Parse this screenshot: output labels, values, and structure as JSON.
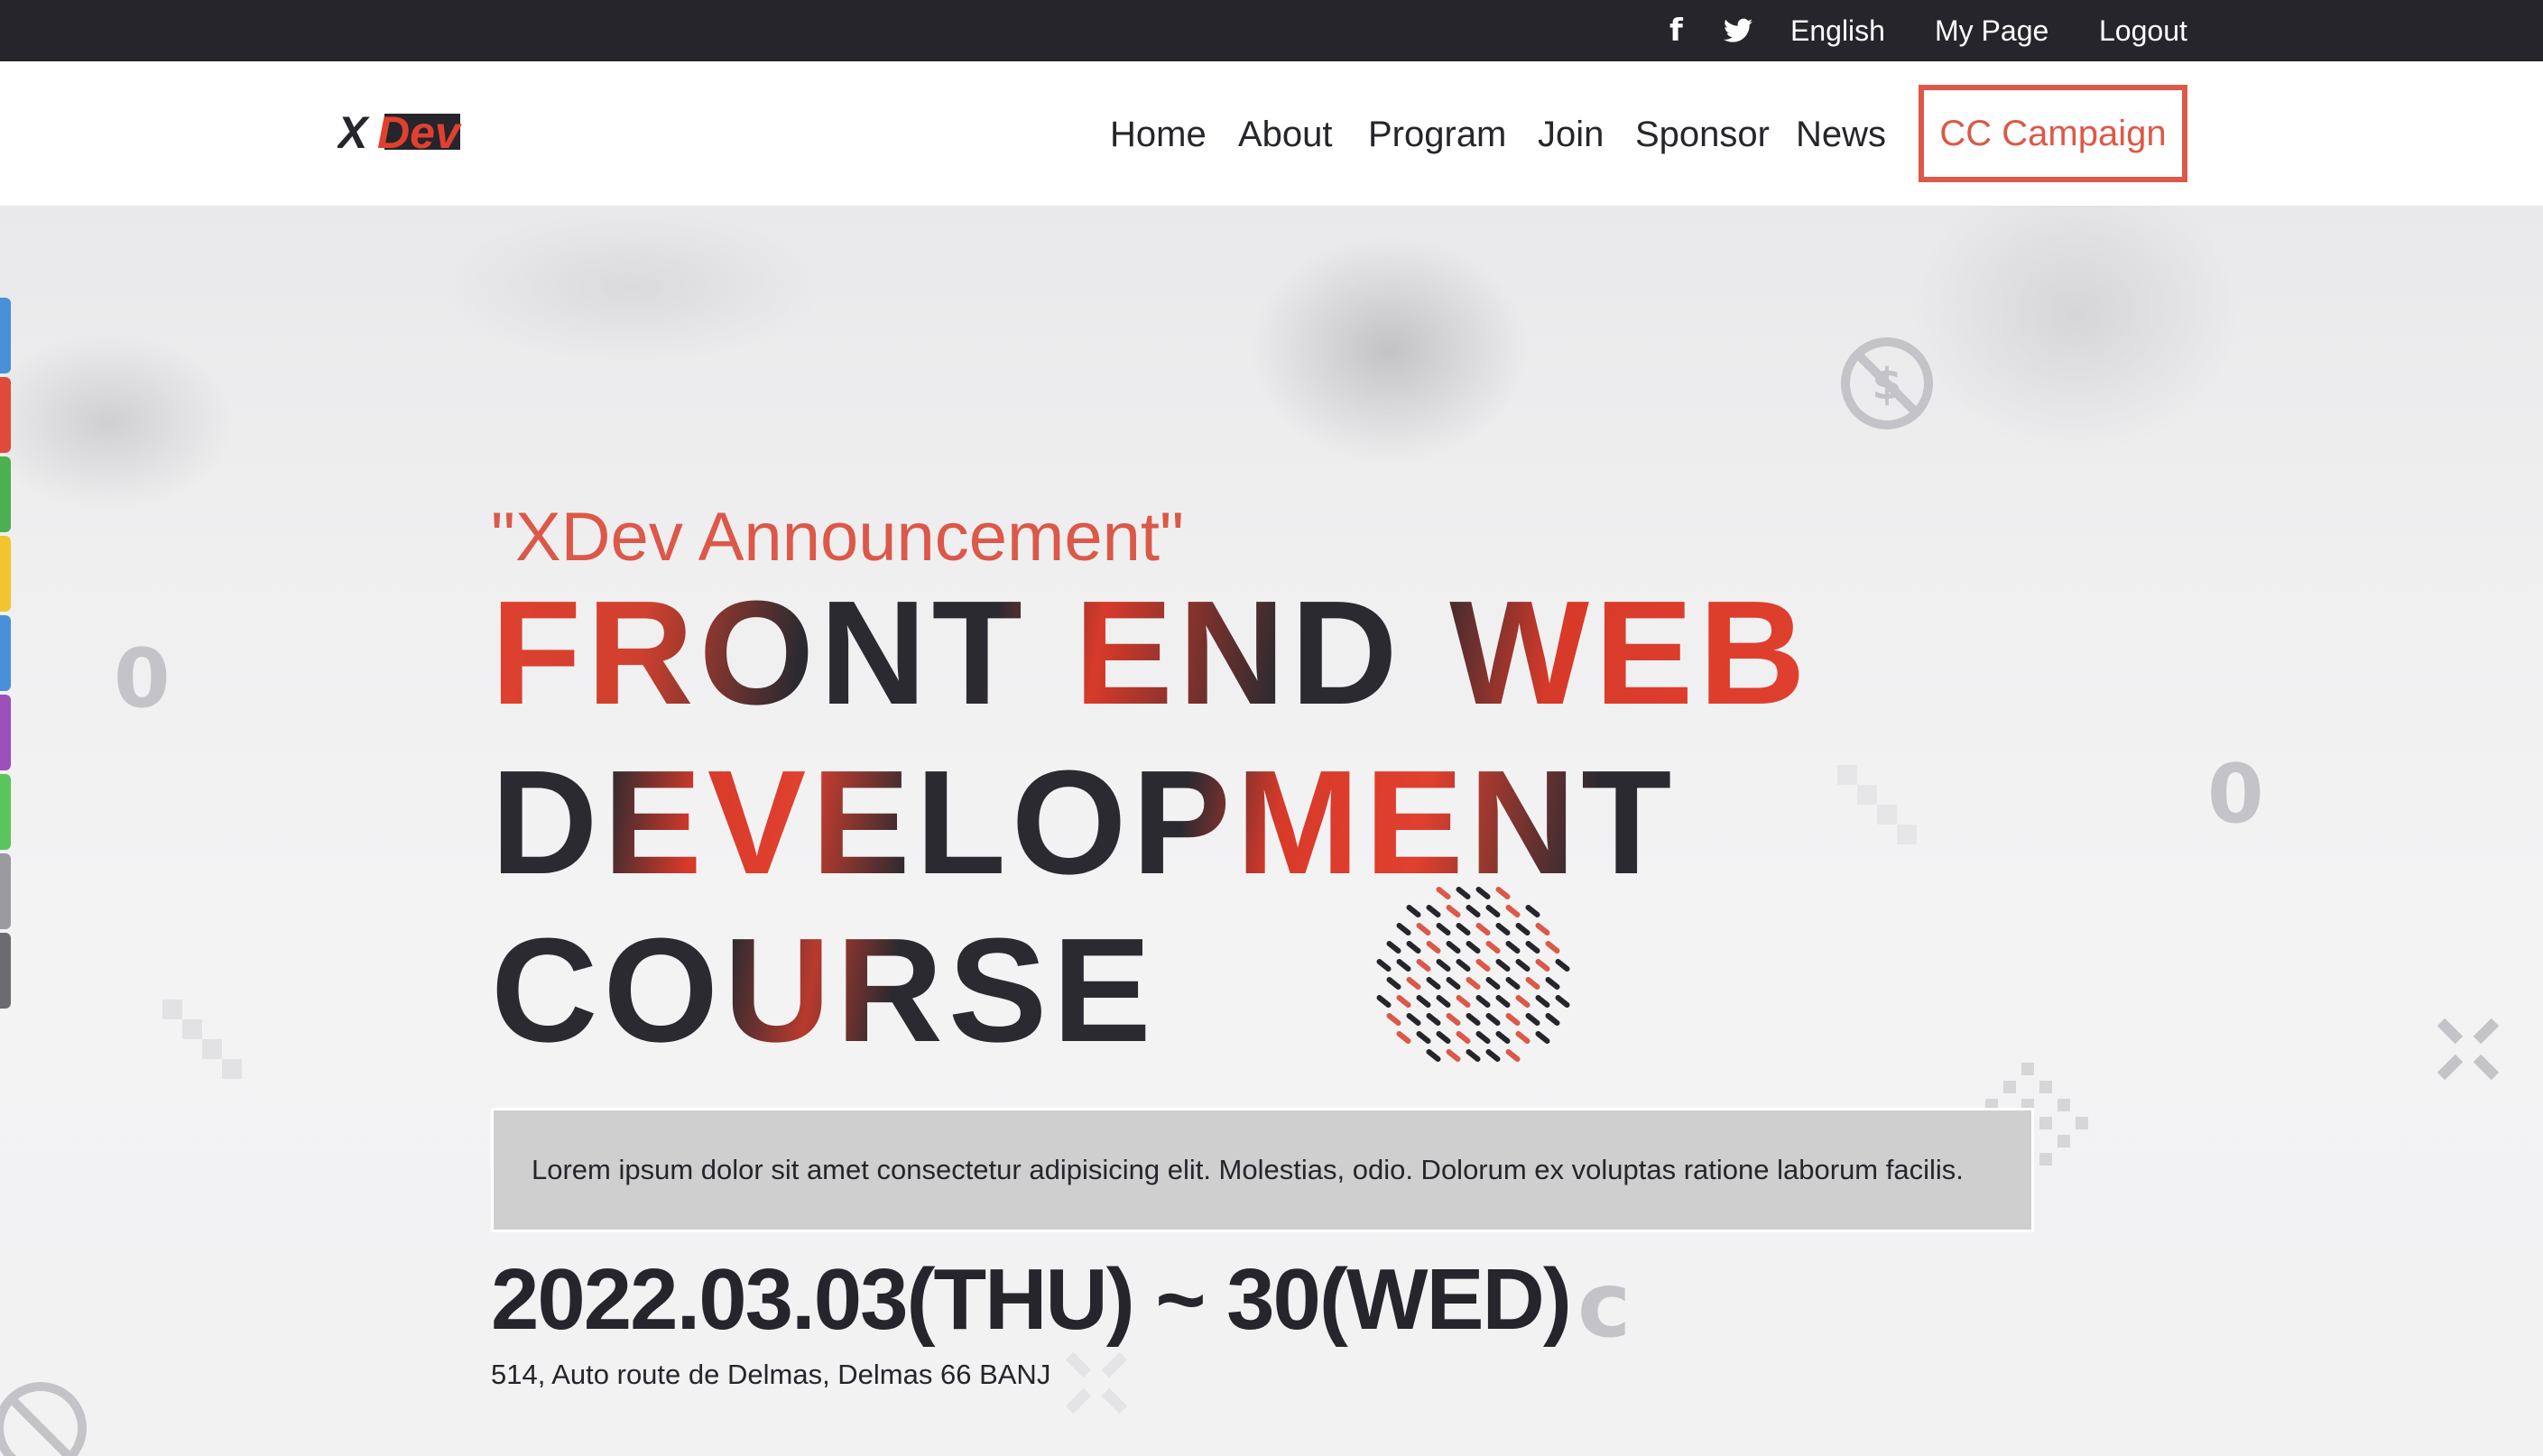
{
  "topbar": {
    "facebook_icon": "f",
    "twitter_icon": "twitter-bird",
    "language": "English",
    "my_page": "My Page",
    "logout": "Logout"
  },
  "header": {
    "logo_text": "XDev",
    "nav": [
      "Home",
      "About",
      "Program",
      "Join",
      "Sponsor",
      "News"
    ],
    "cta": "CC Campaign"
  },
  "hero": {
    "announcement": "\"XDev Announcement\"",
    "title_lines": [
      "FRONT END WEB",
      "DEVELOPMENT",
      "COURSE"
    ],
    "description": "Lorem ipsum dolor sit amet consectetur adipisicing elit. Molestias, odio. Dolorum ex voluptas ratione laborum facilis.",
    "date": "2022.03.03(THU) ~ 30(WED)",
    "address": "514, Auto route de Delmas, Delmas 66 BANJ"
  },
  "colors": {
    "accent": "#dc5848",
    "dark": "#25252b",
    "side_tabs": [
      "#4a90d9",
      "#e04a3a",
      "#4caf50",
      "#f2c530",
      "#4a90d9",
      "#9c4fb8",
      "#5cc45c",
      "#9a9aa0",
      "#6b6b70"
    ]
  }
}
